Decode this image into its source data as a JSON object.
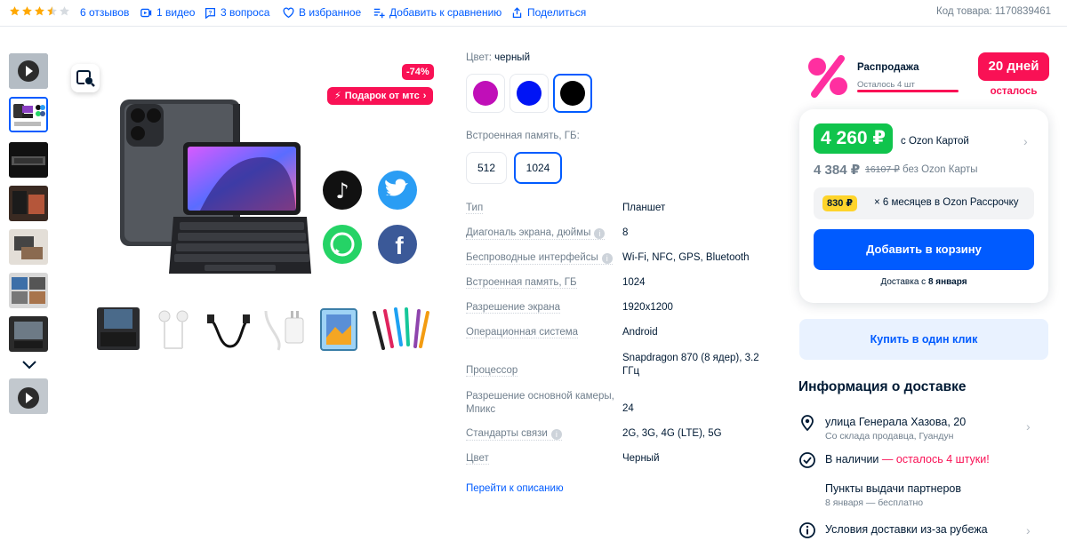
{
  "header": {
    "rating": 3.5,
    "reviews": "6 отзывов",
    "video": "1 видео",
    "questions": "3 вопроса",
    "favorite": "В избранное",
    "compare": "Добавить к сравнению",
    "share": "Поделиться",
    "sku": "Код товара: 1170839461"
  },
  "gallery": {
    "discount_badge": "-74%",
    "gift_badge": "Подарок от мтс",
    "thumb_count": 8,
    "active_thumb": 2
  },
  "options": {
    "color_label": "Цвет:",
    "color_value": "черный",
    "colors": [
      "#c00fb8",
      "#0014f5",
      "#000000"
    ],
    "selected_color": 2,
    "memory_label": "Встроенная память, ГБ:",
    "memory_options": [
      "512",
      "1024"
    ],
    "selected_memory": 1
  },
  "specs": [
    {
      "name": "Тип",
      "value": "Планшет",
      "info": false
    },
    {
      "name": "Диагональ экрана, дюймы",
      "value": "8",
      "info": true
    },
    {
      "name": "Беспроводные интерфейсы",
      "value": "Wi-Fi, NFC, GPS, Bluetooth",
      "info": true
    },
    {
      "name": "Встроенная память, ГБ",
      "value": "1024",
      "info": false
    },
    {
      "name": "Разрешение экрана",
      "value": "1920x1200",
      "info": false
    },
    {
      "name": "Операционная система",
      "value": "Android",
      "info": false
    },
    {
      "name": "Процессор",
      "value": "Snapdragon 870 (8 ядер), 3.2 ГГц",
      "info": false
    },
    {
      "name": "Разрешение основной камеры, Мпикс",
      "value": "24",
      "info": false
    },
    {
      "name": "Стандарты связи",
      "value": "2G, 3G, 4G (LTE), 5G",
      "info": true
    },
    {
      "name": "Цвет",
      "value": "Черный",
      "info": false
    }
  ],
  "go_description": "Перейти к описанию",
  "sale": {
    "title": "Распродажа",
    "left": "Осталось 4 шт",
    "days": "20 дней",
    "days_label": "осталось"
  },
  "price": {
    "ozon_price": "4 260 ₽",
    "ozon_card_label": "с Ozon Картой",
    "price": "4 384 ₽",
    "old_price": "16107 ₽",
    "no_card_label": "без Ozon Карты",
    "installment_badge": "830 ₽",
    "installment_text": "× 6 месяцев в Ozon Рассрочку",
    "cart_button": "Добавить в корзину",
    "delivery_prefix": "Доставка с",
    "delivery_date": "8 января",
    "one_click": "Купить в один клик"
  },
  "delivery": {
    "title": "Информация о доставке",
    "address": "улица Генерала Хазова, 20",
    "address_sub": "Со склада продавца, Гуандун",
    "stock_prefix": "В наличии",
    "stock_alert": "— осталось 4 штуки!",
    "pickup": "Пункты выдачи партнеров",
    "pickup_sub": "8 января — бесплатно",
    "abroad": "Условия доставки из-за рубежа"
  },
  "colors": {
    "accent": "#005bff",
    "sale": "#f91155",
    "ozon_green": "#10c44c"
  }
}
